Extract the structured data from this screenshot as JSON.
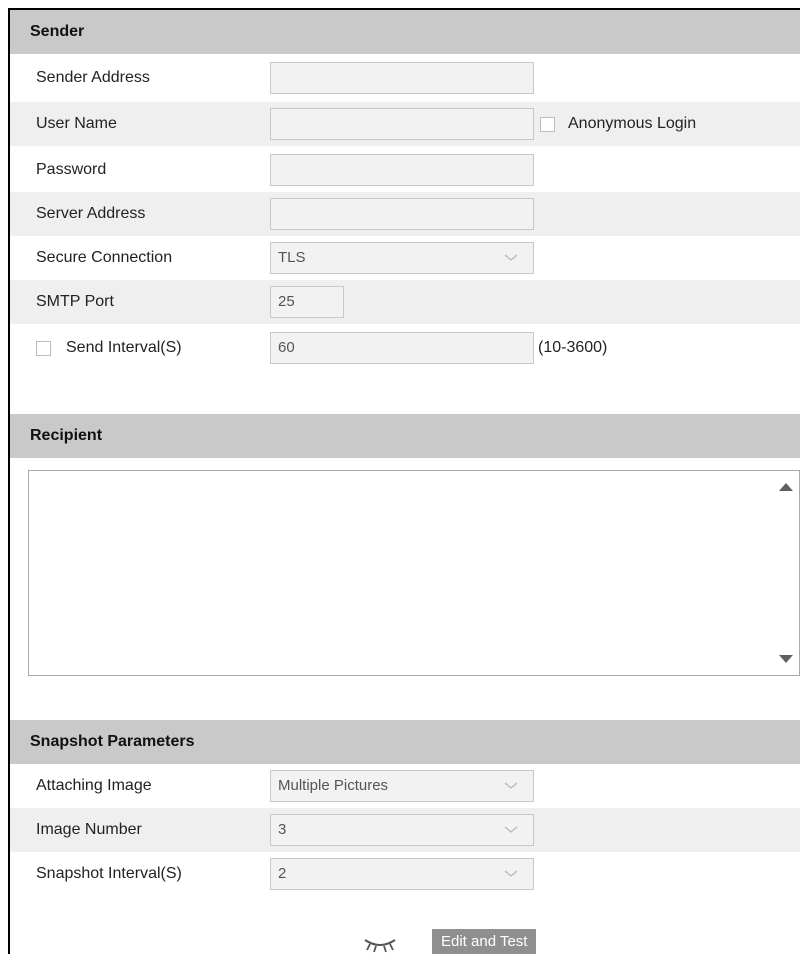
{
  "sender": {
    "header": "Sender",
    "sender_address_label": "Sender Address",
    "sender_address_value": "",
    "user_name_label": "User Name",
    "user_name_value": "",
    "anonymous_login_label": "Anonymous Login",
    "password_label": "Password",
    "password_value": "",
    "server_address_label": "Server Address",
    "server_address_value": "",
    "secure_connection_label": "Secure Connection",
    "secure_connection_value": "TLS",
    "smtp_port_label": "SMTP Port",
    "smtp_port_value": "25",
    "send_interval_label": "Send Interval(S)",
    "send_interval_value": "60",
    "send_interval_range": "(10-3600)"
  },
  "recipient": {
    "header": "Recipient"
  },
  "snapshot": {
    "header": "Snapshot Parameters",
    "attaching_image_label": "Attaching Image",
    "attaching_image_value": "Multiple Pictures",
    "image_number_label": "Image Number",
    "image_number_value": "3",
    "snapshot_interval_label": "Snapshot Interval(S)",
    "snapshot_interval_value": "2"
  },
  "actions": {
    "edit_and_test_label": "Edit and Test"
  },
  "icons": {
    "eye": "eye-closed-icon",
    "select_arrow": "chevron-down-icon",
    "scroll_up": "scroll-up-arrow-icon",
    "scroll_down": "scroll-down-arrow-icon"
  },
  "colors": {
    "header_bg": "#c9c9c9",
    "row_shade": "#efefef",
    "button_bg": "#8f8f8f"
  }
}
